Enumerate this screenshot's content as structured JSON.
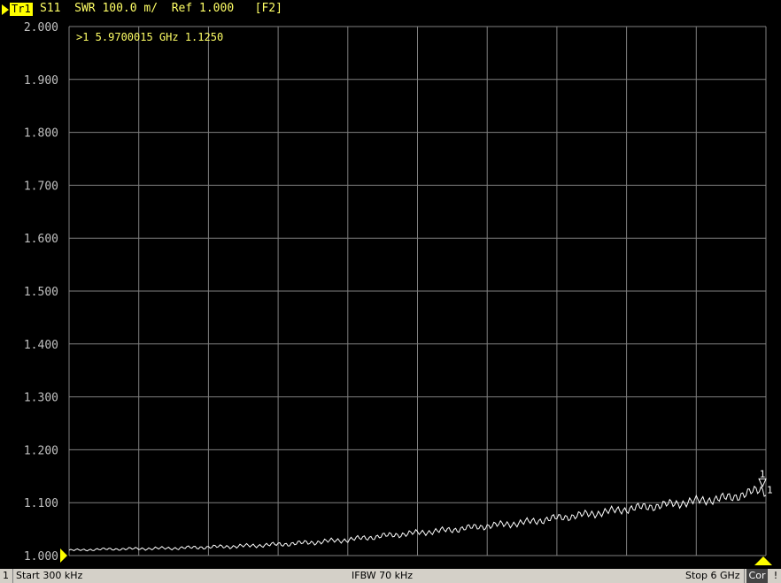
{
  "header": {
    "trace_label": "Tr1",
    "trace_info": "S11  SWR 100.0 m/  Ref 1.000   [F2]"
  },
  "marker_readout": ">1  5.9700015 GHz  1.1250",
  "footer": {
    "channel": "1",
    "start": "Start 300 kHz",
    "ifbw": "IFBW 70 kHz",
    "stop": "Stop 6 GHz",
    "cor": "Cor",
    "warning": "!"
  },
  "colors": {
    "grid": "#808080",
    "trace": "#ffffff",
    "text": "#ffff66",
    "axis_text": "#c0c0c0",
    "marker": "#ffff00"
  },
  "chart_data": {
    "type": "line",
    "title": "",
    "xlabel": "",
    "ylabel": "",
    "xlim": [
      0.0003,
      6.0
    ],
    "ylim": [
      1.0,
      2.0
    ],
    "y_ticks": [
      "2.000",
      "1.900",
      "1.800",
      "1.700",
      "1.600",
      "1.500",
      "1.400",
      "1.300",
      "1.200",
      "1.100",
      "1.000"
    ],
    "x_divisions": 10,
    "grid": true,
    "series": [
      {
        "x": [
          0.0003,
          0.3,
          0.6,
          0.9,
          1.2,
          1.5,
          1.8,
          2.1,
          2.4,
          2.7,
          3.0,
          3.3,
          3.6,
          3.9,
          4.2,
          4.5,
          4.8,
          5.1,
          5.4,
          5.7,
          5.97,
          6.0
        ],
        "y": [
          1.01,
          1.012,
          1.013,
          1.014,
          1.016,
          1.018,
          1.021,
          1.025,
          1.03,
          1.037,
          1.043,
          1.049,
          1.056,
          1.062,
          1.071,
          1.079,
          1.088,
          1.095,
          1.103,
          1.11,
          1.125,
          1.12
        ]
      }
    ],
    "marker": {
      "label": "1",
      "x": 5.97,
      "y": 1.125
    }
  }
}
